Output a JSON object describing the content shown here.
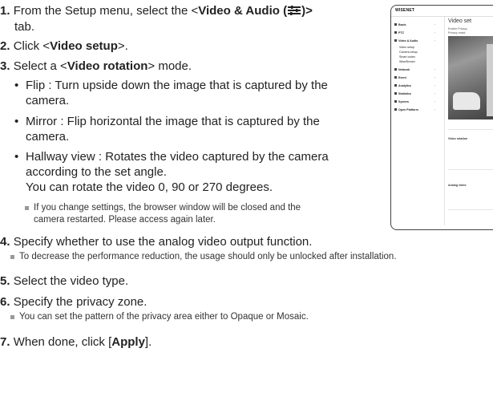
{
  "steps": [
    {
      "num": "1.",
      "pre": "From the Setup menu, select the <",
      "bold": "Video & Audio (",
      "post": ")>",
      "cont": "tab."
    },
    {
      "num": "2.",
      "pre": "Click <",
      "bold": "Video setup",
      "post": ">."
    },
    {
      "num": "3.",
      "pre": "Select a <",
      "bold": "Video rotation",
      "post": "> mode."
    },
    {
      "num": "4.",
      "text": "Specify whether to use the analog video output function."
    },
    {
      "num": "5.",
      "text": "Select the video type."
    },
    {
      "num": "6.",
      "text": "Specify the privacy zone."
    },
    {
      "num": "7.",
      "pre": "When done, click [",
      "bold": "Apply",
      "post": "]."
    }
  ],
  "bullets": [
    {
      "l1": "Flip : Turn upside down the image that is captured by the",
      "l2": "camera."
    },
    {
      "l1": "Mirror : Flip horizontal the image that is captured by the",
      "l2": "camera."
    },
    {
      "l1": "Hallway view : Rotates the video captured by the camera",
      "l2": "according to the set angle.",
      "l3": "You can rotate the video 0, 90 or 270 degrees."
    }
  ],
  "notes": {
    "rotation_l1": "If you change settings, the browser window will be closed and the",
    "rotation_l2": "camera restarted. Please access again later.",
    "analog": "To decrease the performance reduction, the usage should only be unlocked after installation.",
    "privacy": "You can set the pattern of the privacy area either to Opaque or Mosaic."
  },
  "screenshot": {
    "brand": "WISENET",
    "title": "Video set",
    "menu": [
      {
        "label": "Basic",
        "chev": "›"
      },
      {
        "label": "PTZ",
        "chev": "›"
      },
      {
        "label": "Video & Audio",
        "chev": "›"
      },
      {
        "label": "Video setup"
      },
      {
        "label": "Camera setup"
      },
      {
        "label": "Smart codec"
      },
      {
        "label": "WiseStream"
      },
      {
        "label": "Network",
        "chev": "›"
      },
      {
        "label": "Event",
        "chev": "›"
      },
      {
        "label": "Analytics",
        "chev": "›"
      },
      {
        "label": "Statistics",
        "chev": "›"
      },
      {
        "label": "System",
        "chev": "›"
      },
      {
        "label": "Open Platform",
        "chev": "›"
      }
    ],
    "content_labels": {
      "enable": "Enable Privacy",
      "privacy": "Privacy mask",
      "rotation": "Video rotation",
      "analog": "Analog video"
    }
  }
}
